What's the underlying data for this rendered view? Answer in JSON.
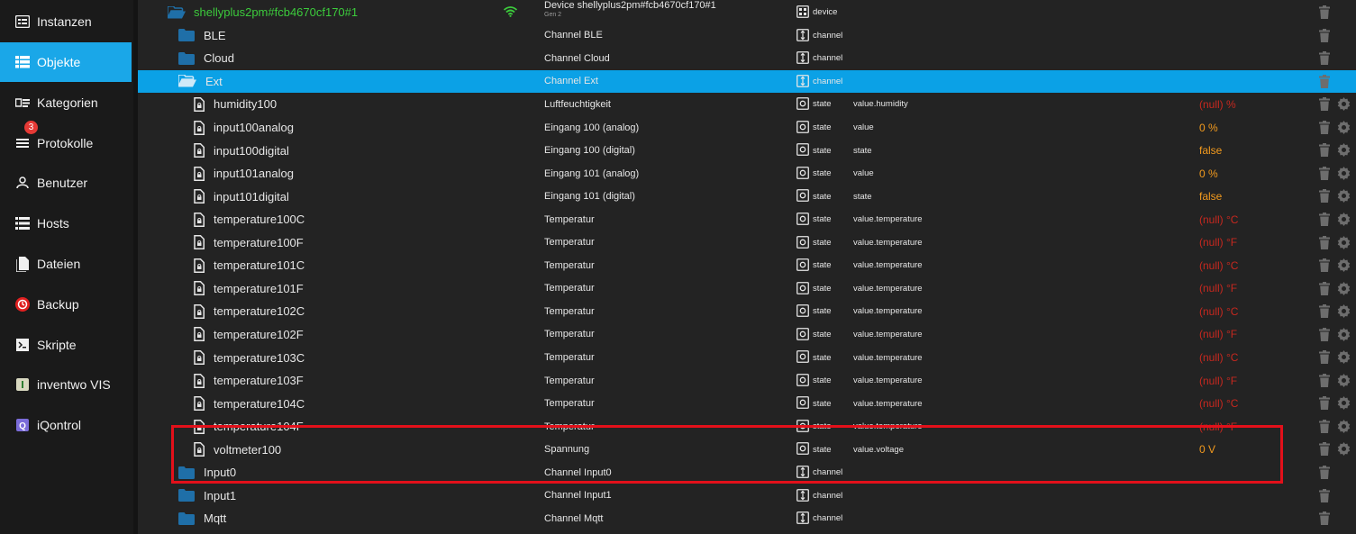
{
  "sidebar": {
    "items": [
      {
        "label": "Instanzen",
        "icon": "instances-icon",
        "active": false
      },
      {
        "label": "Objekte",
        "icon": "objects-list-icon",
        "active": true
      },
      {
        "label": "Kategorien",
        "icon": "categories-icon",
        "active": false
      },
      {
        "label": "Protokolle",
        "icon": "logs-icon",
        "active": false,
        "badge": "3"
      },
      {
        "label": "Benutzer",
        "icon": "user-icon",
        "active": false
      },
      {
        "label": "Hosts",
        "icon": "hosts-icon",
        "active": false
      },
      {
        "label": "Dateien",
        "icon": "files-icon",
        "active": false
      },
      {
        "label": "Backup",
        "icon": "backup-icon",
        "active": false
      },
      {
        "label": "Skripte",
        "icon": "scripts-icon",
        "active": false
      },
      {
        "label": "inventwo VIS",
        "icon": "inventwo-icon",
        "active": false
      },
      {
        "label": "iQontrol",
        "icon": "iqontrol-icon",
        "active": false
      }
    ]
  },
  "colors": {
    "accent": "#1aa7e8",
    "selected_row": "#0ba1e6",
    "device_name": "#3ccb3c",
    "value_ok": "#f29a1e",
    "value_null": "#c6281f",
    "highlight_box": "#e3101a"
  },
  "rows": [
    {
      "name": "shellyplus2pm#fcb4670cf170#1",
      "kind": "device",
      "desc": "Device shellyplus2pm#fcb4670cf170#1",
      "desc_sub": "Gen 2",
      "type": "device",
      "role": "",
      "value": "",
      "wifi": true
    },
    {
      "name": "BLE",
      "kind": "channel",
      "desc": "Channel BLE",
      "type": "channel",
      "role": "",
      "value": ""
    },
    {
      "name": "Cloud",
      "kind": "channel",
      "desc": "Channel Cloud",
      "type": "channel",
      "role": "",
      "value": ""
    },
    {
      "name": "Ext",
      "kind": "channel",
      "open": true,
      "selected": true,
      "desc": "Channel Ext",
      "type": "channel",
      "role": "",
      "value": ""
    },
    {
      "name": "humidity100",
      "kind": "state",
      "desc": "Luftfeuchtigkeit",
      "type": "state",
      "role": "value.humidity",
      "value": "(null) %",
      "vclass": "red"
    },
    {
      "name": "input100analog",
      "kind": "state",
      "desc": "Eingang 100 (analog)",
      "type": "state",
      "role": "value",
      "value": "0 %",
      "vclass": "orange"
    },
    {
      "name": "input100digital",
      "kind": "state",
      "desc": "Eingang 100 (digital)",
      "type": "state",
      "role": "state",
      "value": "false",
      "vclass": "orange"
    },
    {
      "name": "input101analog",
      "kind": "state",
      "desc": "Eingang 101 (analog)",
      "type": "state",
      "role": "value",
      "value": "0 %",
      "vclass": "orange"
    },
    {
      "name": "input101digital",
      "kind": "state",
      "desc": "Eingang 101 (digital)",
      "type": "state",
      "role": "state",
      "value": "false",
      "vclass": "orange"
    },
    {
      "name": "temperature100C",
      "kind": "state",
      "desc": "Temperatur",
      "type": "state",
      "role": "value.temperature",
      "value": "(null) °C",
      "vclass": "red"
    },
    {
      "name": "temperature100F",
      "kind": "state",
      "desc": "Temperatur",
      "type": "state",
      "role": "value.temperature",
      "value": "(null) °F",
      "vclass": "red"
    },
    {
      "name": "temperature101C",
      "kind": "state",
      "desc": "Temperatur",
      "type": "state",
      "role": "value.temperature",
      "value": "(null) °C",
      "vclass": "red"
    },
    {
      "name": "temperature101F",
      "kind": "state",
      "desc": "Temperatur",
      "type": "state",
      "role": "value.temperature",
      "value": "(null) °F",
      "vclass": "red"
    },
    {
      "name": "temperature102C",
      "kind": "state",
      "desc": "Temperatur",
      "type": "state",
      "role": "value.temperature",
      "value": "(null) °C",
      "vclass": "red"
    },
    {
      "name": "temperature102F",
      "kind": "state",
      "desc": "Temperatur",
      "type": "state",
      "role": "value.temperature",
      "value": "(null) °F",
      "vclass": "red"
    },
    {
      "name": "temperature103C",
      "kind": "state",
      "desc": "Temperatur",
      "type": "state",
      "role": "value.temperature",
      "value": "(null) °C",
      "vclass": "red"
    },
    {
      "name": "temperature103F",
      "kind": "state",
      "desc": "Temperatur",
      "type": "state",
      "role": "value.temperature",
      "value": "(null) °F",
      "vclass": "red"
    },
    {
      "name": "temperature104C",
      "kind": "state",
      "desc": "Temperatur",
      "type": "state",
      "role": "value.temperature",
      "value": "(null) °C",
      "vclass": "red"
    },
    {
      "name": "temperature104F",
      "kind": "state",
      "desc": "Temperatur",
      "type": "state",
      "role": "value.temperature",
      "value": "(null) °F",
      "vclass": "red"
    },
    {
      "name": "voltmeter100",
      "kind": "state",
      "desc": "Spannung",
      "type": "state",
      "role": "value.voltage",
      "value": "0 V",
      "vclass": "orange"
    },
    {
      "name": "Input0",
      "kind": "channel",
      "desc": "Channel Input0",
      "type": "channel",
      "role": "",
      "value": ""
    },
    {
      "name": "Input1",
      "kind": "channel",
      "desc": "Channel Input1",
      "type": "channel",
      "role": "",
      "value": ""
    },
    {
      "name": "Mqtt",
      "kind": "channel",
      "desc": "Channel Mqtt",
      "type": "channel",
      "role": "",
      "value": ""
    }
  ]
}
